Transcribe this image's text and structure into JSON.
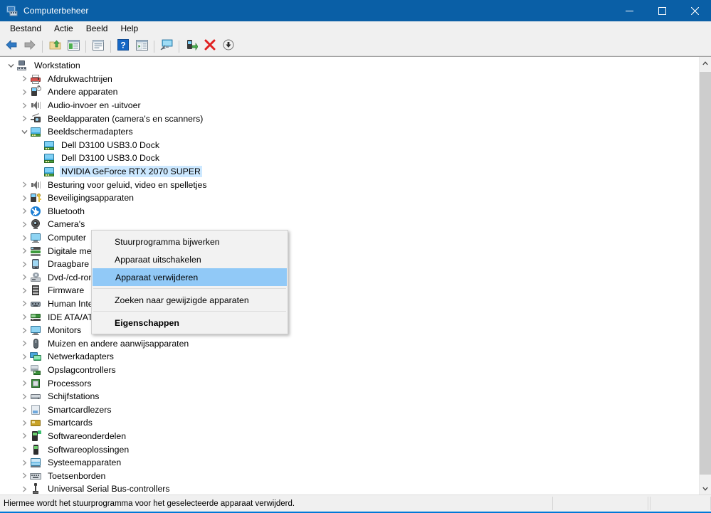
{
  "window": {
    "title": "Computerbeheer",
    "icon": "computer-management-icon",
    "caption": {
      "minimize": "Minimaliseren",
      "maximize": "Maximaliseren",
      "close": "Sluiten"
    },
    "accent_color": "#0a5fa6"
  },
  "menubar": {
    "items": [
      {
        "label": "Bestand"
      },
      {
        "label": "Actie"
      },
      {
        "label": "Beeld"
      },
      {
        "label": "Help"
      }
    ]
  },
  "toolbar": {
    "buttons": [
      {
        "name": "back-button",
        "icon": "arrow-left-icon"
      },
      {
        "name": "forward-button",
        "icon": "arrow-right-icon"
      },
      {
        "name": "up-one-level-button",
        "icon": "folder-up-icon"
      },
      {
        "name": "show-hide-console-tree-button",
        "icon": "console-tree-icon"
      },
      {
        "name": "properties-button",
        "icon": "properties-icon"
      },
      {
        "name": "help-button",
        "icon": "help-question-icon"
      },
      {
        "name": "show-hide-action-pane-button",
        "icon": "action-pane-icon"
      },
      {
        "name": "scan-for-hardware-changes-button",
        "icon": "monitor-scan-icon"
      },
      {
        "name": "update-driver-button",
        "icon": "update-driver-icon"
      },
      {
        "name": "uninstall-device-button",
        "icon": "red-x-icon"
      },
      {
        "name": "disable-device-button",
        "icon": "down-arrow-circle-icon"
      }
    ]
  },
  "tree": {
    "rows": [
      {
        "label": "Workstation",
        "depth": 0,
        "twist": "expanded",
        "icon": "ico-workstation",
        "icon_name": "workstation-icon"
      },
      {
        "label": "Afdrukwachtrijen",
        "depth": 1,
        "twist": "collapsed",
        "icon": "ico-printer",
        "icon_name": "print-queue-icon"
      },
      {
        "label": "Andere apparaten",
        "depth": 1,
        "twist": "collapsed",
        "icon": "ico-unknown",
        "icon_name": "unknown-device-icon"
      },
      {
        "label": "Audio-invoer en -uitvoer",
        "depth": 1,
        "twist": "collapsed",
        "icon": "ico-audio",
        "icon_name": "audio-icon"
      },
      {
        "label": "Beeldapparaten (camera's en scanners)",
        "depth": 1,
        "twist": "collapsed",
        "icon": "ico-imaging",
        "icon_name": "imaging-device-icon"
      },
      {
        "label": "Beeldschermadapters",
        "depth": 1,
        "twist": "expanded",
        "icon": "ico-display",
        "icon_name": "display-adapter-icon"
      },
      {
        "label": "Dell D3100 USB3.0 Dock",
        "depth": 2,
        "twist": "none",
        "icon": "ico-display",
        "icon_name": "display-adapter-icon"
      },
      {
        "label": "Dell D3100 USB3.0 Dock",
        "depth": 2,
        "twist": "none",
        "icon": "ico-display",
        "icon_name": "display-adapter-icon"
      },
      {
        "label": "NVIDIA GeForce RTX 2070 SUPER",
        "depth": 2,
        "twist": "none",
        "icon": "ico-display",
        "icon_name": "display-adapter-icon",
        "selected": true
      },
      {
        "label": "Besturing voor geluid, video en spelletjes",
        "depth": 1,
        "twist": "collapsed",
        "icon": "ico-audio",
        "icon_name": "sound-video-game-controller-icon"
      },
      {
        "label": "Beveiligingsapparaten",
        "depth": 1,
        "twist": "collapsed",
        "icon": "ico-security",
        "icon_name": "security-device-icon"
      },
      {
        "label": "Bluetooth",
        "depth": 1,
        "twist": "collapsed",
        "icon": "ico-bt",
        "icon_name": "bluetooth-icon"
      },
      {
        "label": "Camera's",
        "depth": 1,
        "twist": "collapsed",
        "icon": "ico-webcam",
        "icon_name": "camera-icon"
      },
      {
        "label": "Computer",
        "depth": 1,
        "twist": "collapsed",
        "icon": "ico-monitor",
        "icon_name": "computer-icon"
      },
      {
        "label": "Digitale mediaapparaten",
        "depth": 1,
        "twist": "collapsed",
        "icon": "ico-media",
        "icon_name": "digital-media-device-icon"
      },
      {
        "label": "Draagbare apparaten",
        "depth": 1,
        "twist": "collapsed",
        "icon": "ico-portable",
        "icon_name": "portable-device-icon"
      },
      {
        "label": "Dvd-/cd-rom-stations",
        "depth": 1,
        "twist": "collapsed",
        "icon": "ico-dvd",
        "icon_name": "dvd-cdrom-icon"
      },
      {
        "label": "Firmware",
        "depth": 1,
        "twist": "collapsed",
        "icon": "ico-firmware",
        "icon_name": "firmware-icon"
      },
      {
        "label": "Human Interface-apparaten (HID)",
        "depth": 1,
        "twist": "collapsed",
        "icon": "ico-hid",
        "icon_name": "hid-icon"
      },
      {
        "label": "IDE ATA/ATAPI-controllers",
        "depth": 1,
        "twist": "collapsed",
        "icon": "ico-ide",
        "icon_name": "ide-ata-controller-icon"
      },
      {
        "label": "Monitors",
        "depth": 1,
        "twist": "collapsed",
        "icon": "ico-monitor",
        "icon_name": "monitor-icon"
      },
      {
        "label": "Muizen en andere aanwijsapparaten",
        "depth": 1,
        "twist": "collapsed",
        "icon": "ico-mouse",
        "icon_name": "mouse-icon"
      },
      {
        "label": "Netwerkadapters",
        "depth": 1,
        "twist": "collapsed",
        "icon": "ico-net",
        "icon_name": "network-adapter-icon"
      },
      {
        "label": "Opslagcontrollers",
        "depth": 1,
        "twist": "collapsed",
        "icon": "ico-storage",
        "icon_name": "storage-controller-icon"
      },
      {
        "label": "Processors",
        "depth": 1,
        "twist": "collapsed",
        "icon": "ico-cpu",
        "icon_name": "processor-icon"
      },
      {
        "label": "Schijfstations",
        "depth": 1,
        "twist": "collapsed",
        "icon": "ico-disk",
        "icon_name": "disk-drive-icon"
      },
      {
        "label": "Smartcardlezers",
        "depth": 1,
        "twist": "collapsed",
        "icon": "ico-scr",
        "icon_name": "smartcard-reader-icon"
      },
      {
        "label": "Smartcards",
        "depth": 1,
        "twist": "collapsed",
        "icon": "ico-sc",
        "icon_name": "smartcard-icon"
      },
      {
        "label": "Softwareonderdelen",
        "depth": 1,
        "twist": "collapsed",
        "icon": "ico-swcomp",
        "icon_name": "software-component-icon"
      },
      {
        "label": "Softwareoplossingen",
        "depth": 1,
        "twist": "collapsed",
        "icon": "ico-swdev",
        "icon_name": "software-device-icon"
      },
      {
        "label": "Systeemapparaten",
        "depth": 1,
        "twist": "collapsed",
        "icon": "ico-sys",
        "icon_name": "system-device-icon"
      },
      {
        "label": "Toetsenborden",
        "depth": 1,
        "twist": "collapsed",
        "icon": "ico-kb",
        "icon_name": "keyboard-icon"
      },
      {
        "label": "Universal Serial Bus-controllers",
        "depth": 1,
        "twist": "collapsed",
        "icon": "ico-usb",
        "icon_name": "usb-controller-icon"
      }
    ]
  },
  "context_menu": {
    "highlight_color": "#91c9f7",
    "items": [
      {
        "label": "Stuurprogramma bijwerken",
        "type": "item",
        "name": "ctx-update-driver"
      },
      {
        "label": "Apparaat uitschakelen",
        "type": "item",
        "name": "ctx-disable-device"
      },
      {
        "label": "Apparaat verwijderen",
        "type": "item",
        "name": "ctx-uninstall-device",
        "highlighted": true
      },
      {
        "type": "separator"
      },
      {
        "label": "Zoeken naar gewijzigde apparaten",
        "type": "item",
        "name": "ctx-scan-hardware-changes"
      },
      {
        "type": "separator"
      },
      {
        "label": "Eigenschappen",
        "type": "item-bold",
        "name": "ctx-properties"
      }
    ]
  },
  "statusbar": {
    "text": "Hiermee wordt het stuurprogramma voor het geselecteerde apparaat verwijderd."
  },
  "scrollbar": {
    "up_arrow": "chevron-up-icon",
    "down_arrow": "chevron-down-icon"
  }
}
